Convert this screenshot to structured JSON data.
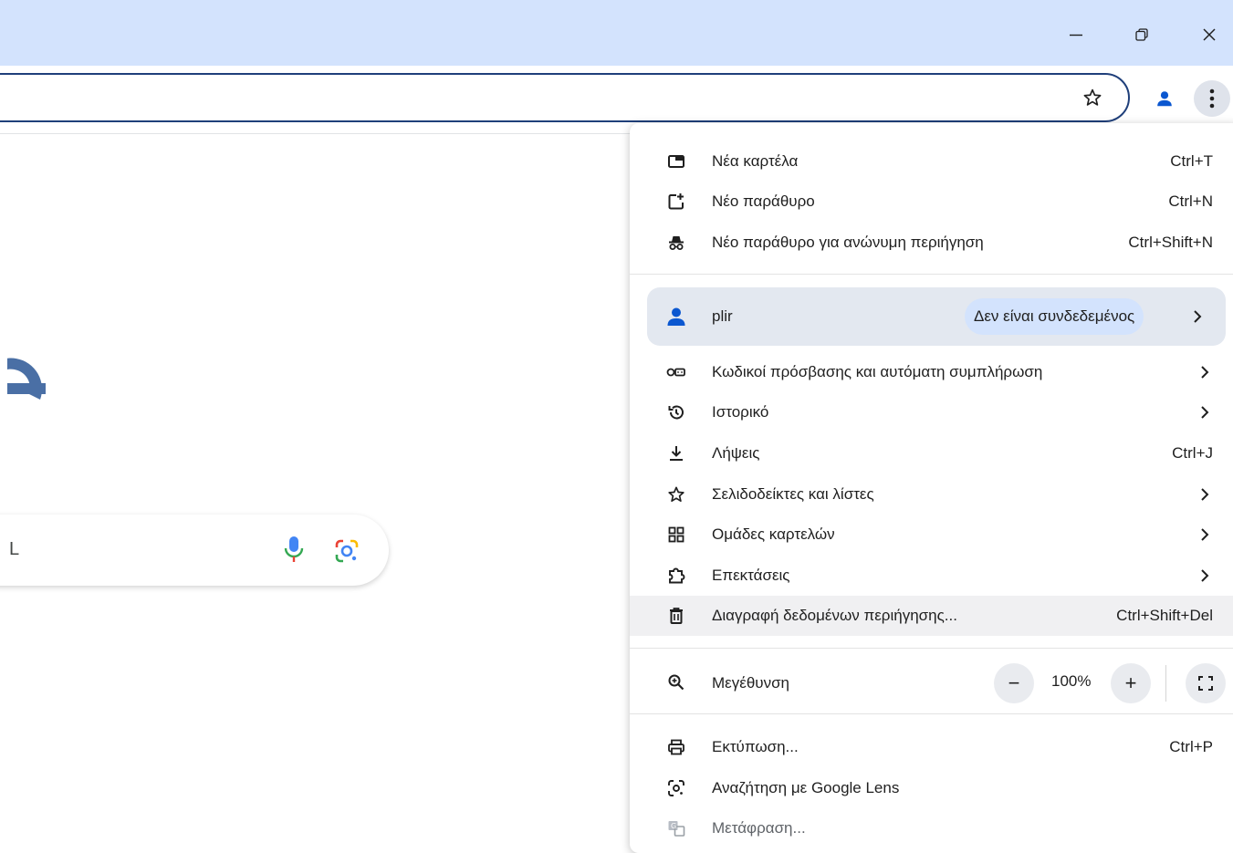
{
  "window": {
    "minimize_icon": "minimize-icon",
    "restore_icon": "restore-icon",
    "close_icon": "close-icon"
  },
  "toolbar": {
    "bookmark_icon": "star-outline-icon",
    "profile_icon": "person-icon",
    "menu_icon": "three-dots-vertical-icon"
  },
  "page": {
    "search_partial_text": "L",
    "mic_icon": "microphone-icon",
    "lens_icon": "google-lens-icon"
  },
  "menu": {
    "new_tab": {
      "label": "Νέα καρτέλα",
      "shortcut": "Ctrl+T"
    },
    "new_window": {
      "label": "Νέο παράθυρο",
      "shortcut": "Ctrl+N"
    },
    "incognito": {
      "label": "Νέο παράθυρο για ανώνυμη περιήγηση",
      "shortcut": "Ctrl+Shift+N"
    },
    "profile": {
      "name": "plir",
      "status": "Δεν είναι συνδεδεμένος"
    },
    "passwords": {
      "label": "Κωδικοί πρόσβασης και αυτόματη συμπλήρωση"
    },
    "history": {
      "label": "Ιστορικό"
    },
    "downloads": {
      "label": "Λήψεις",
      "shortcut": "Ctrl+J"
    },
    "bookmarks": {
      "label": "Σελιδοδείκτες και λίστες"
    },
    "tab_groups": {
      "label": "Ομάδες καρτελών"
    },
    "extensions": {
      "label": "Επεκτάσεις"
    },
    "clear_data": {
      "label": "Διαγραφή δεδομένων περιήγησης...",
      "shortcut": "Ctrl+Shift+Del"
    },
    "zoom": {
      "label": "Μεγέθυνση",
      "minus": "−",
      "value": "100%",
      "plus": "+"
    },
    "print": {
      "label": "Εκτύπωση...",
      "shortcut": "Ctrl+P"
    },
    "lens": {
      "label": "Αναζήτηση με Google Lens"
    },
    "translate": {
      "label": "Μετάφραση..."
    }
  },
  "colors": {
    "titlebar": "#d3e3fd",
    "accent_blue": "#0b57d0",
    "google_e_blue": "#4a6fa5"
  }
}
